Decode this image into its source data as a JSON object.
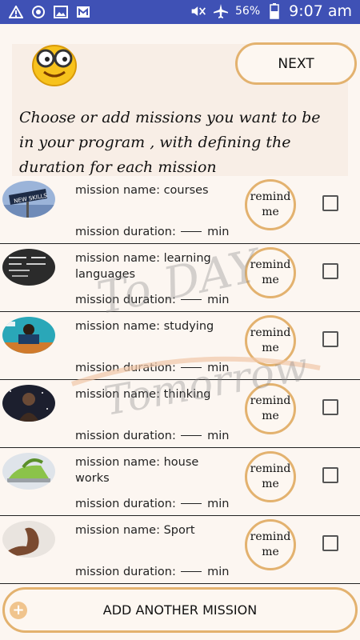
{
  "status_bar": {
    "battery_percent": "56%",
    "time": "9:07 am",
    "left_icons": [
      "warning-icon",
      "sync-icon",
      "image-icon",
      "gallery-icon"
    ],
    "right_icons": [
      "mute-icon",
      "airplane-icon",
      "battery-icon"
    ]
  },
  "header": {
    "next_label": "NEXT",
    "instructions": "Choose or add missions you want to be in your program , with defining the duration for each mission"
  },
  "missions": [
    {
      "name": "mission name: courses",
      "duration_label": "mission duration:",
      "unit": "min",
      "remind": "remind me",
      "checked": false,
      "thumb": "new-skills-sign-icon"
    },
    {
      "name": "mission name: learning languages",
      "duration_label": "mission duration:",
      "unit": "min",
      "remind": "remind me",
      "checked": false,
      "thumb": "chalkboard-icon"
    },
    {
      "name": "mission name: studying",
      "duration_label": "mission duration:",
      "unit": "min",
      "remind": "remind me",
      "checked": false,
      "thumb": "student-desk-icon"
    },
    {
      "name": "mission name: thinking",
      "duration_label": "mission duration:",
      "unit": "min",
      "remind": "remind me",
      "checked": false,
      "thumb": "night-sky-thinker-icon"
    },
    {
      "name": "mission name: house works",
      "duration_label": "mission duration:",
      "unit": "min",
      "remind": "remind me",
      "checked": false,
      "thumb": "iron-icon"
    },
    {
      "name": "mission name: Sport",
      "duration_label": "mission duration:",
      "unit": "min",
      "remind": "remind me",
      "checked": false,
      "thumb": "flexed-arm-icon"
    }
  ],
  "footer": {
    "add_label": "ADD ANOTHER MISSION"
  },
  "watermark": {
    "line1": "To DAY",
    "line2": "Tomorrow"
  },
  "colors": {
    "statusbar": "#3f51b5",
    "accent_border": "#e3b26f",
    "background": "#fcf6f1"
  }
}
